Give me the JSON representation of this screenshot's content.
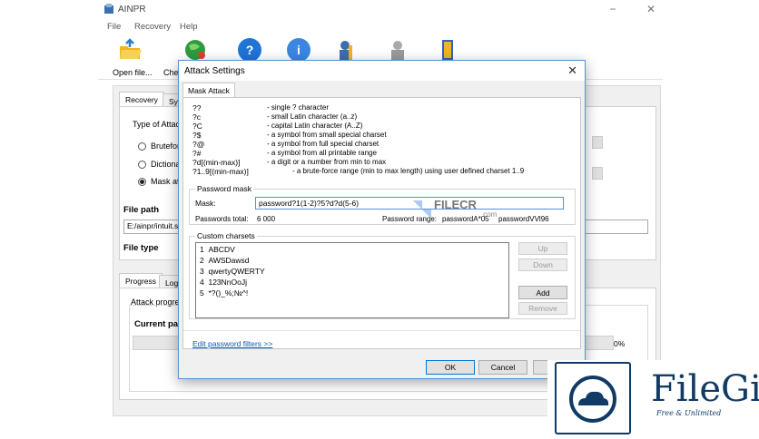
{
  "app": {
    "title": "AINPR",
    "minimize": "−",
    "maximize": "□",
    "close": "✕"
  },
  "menu": [
    "File",
    "Recovery",
    "Help"
  ],
  "toolbar": {
    "open_label": "Open file...",
    "check_label": "Chec"
  },
  "main": {
    "tabs_top": [
      "Recovery",
      "Syst"
    ],
    "attack_group_label": "Type of Attack",
    "radios": [
      "Bruteforce",
      "Dictionary",
      "Mask attac"
    ],
    "file_path_label": "File path",
    "file_path_value": "E:/ainpr/intuit.sa",
    "file_type_label": "File type",
    "tabs_bottom": [
      "Progress",
      "Log"
    ],
    "attack_progress_label": "Attack progress",
    "current_pass_label": "Current pass",
    "percent": "0%"
  },
  "dialog": {
    "title": "Attack Settings",
    "close": "✕",
    "tab": "Mask Attack",
    "legend": [
      {
        "key": "??",
        "desc": "- single ? character"
      },
      {
        "key": "?c",
        "desc": "- small Latin character (a..z)"
      },
      {
        "key": "?C",
        "desc": "- capital Latin character (A..Z)"
      },
      {
        "key": "?$",
        "desc": "- a symbol from small special charset"
      },
      {
        "key": "?@",
        "desc": "- a symbol from full special charset"
      },
      {
        "key": "?#",
        "desc": "- a symbol from all printable range"
      },
      {
        "key": "?d[(min-max)]",
        "desc": "- a digit or a number from min to max"
      },
      {
        "key": "?1..9[(min-max)]",
        "desc": "- a brute-force range (min to max length) using user defined charset 1..9"
      }
    ],
    "password_mask": {
      "title": "Password mask",
      "mask_label": "Mask:",
      "mask_value": "password?1(1-2)?5?d?d(5-6)",
      "total_label": "Passwords total:",
      "total_value": "6 000",
      "range_label": "Password range:",
      "range_from": "passwordA*05",
      "range_to": "passwordVVl96"
    },
    "charsets": {
      "title": "Custom charsets",
      "items": [
        {
          "num": "1",
          "value": "ABCDV"
        },
        {
          "num": "2",
          "value": "AWSDawsd"
        },
        {
          "num": "3",
          "value": "qwertyQWERTY"
        },
        {
          "num": "4",
          "value": "123NnOoJj"
        },
        {
          "num": "5",
          "value": "*?()_%;№^!"
        }
      ],
      "up": "Up",
      "down": "Down",
      "add": "Add",
      "remove": "Remove"
    },
    "edit_link": "Edit password filters >>",
    "ok": "OK",
    "cancel": "Cancel"
  },
  "watermarks": {
    "filecr": "FILECR",
    "filecr_sub": ".com",
    "filegit": "FileGit",
    "filegit_tagline": "Free & Unlimited"
  }
}
